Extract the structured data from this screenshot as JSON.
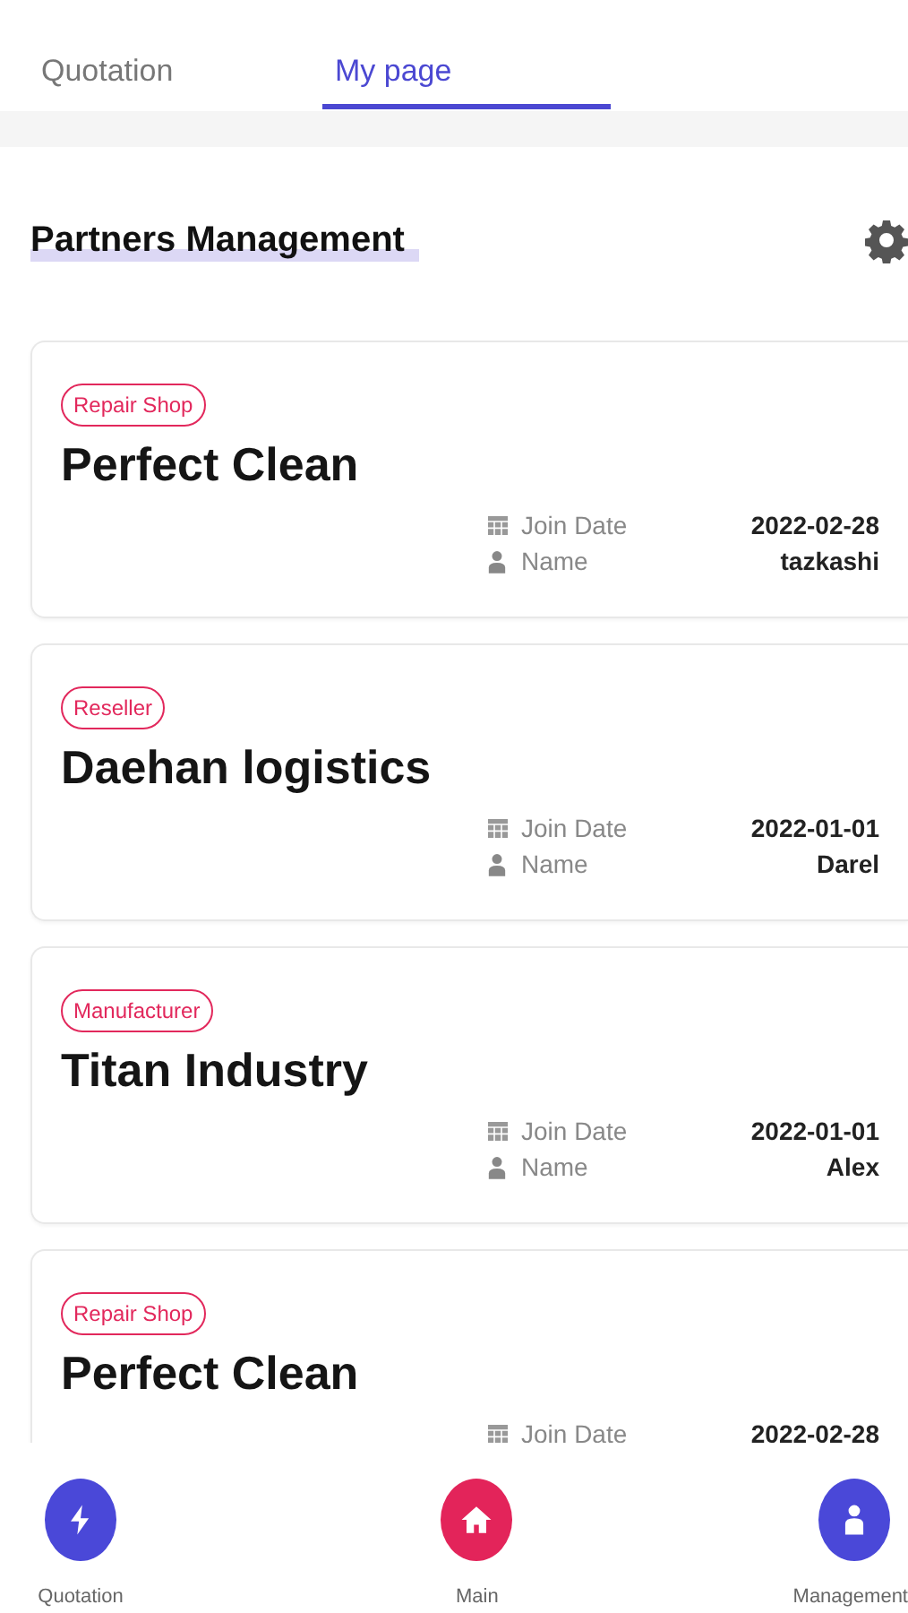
{
  "tabs": [
    {
      "label": "Quotation",
      "selected": false
    },
    {
      "label": "My page",
      "selected": true
    }
  ],
  "section": {
    "title": "Partners Management"
  },
  "partners": [
    {
      "tag": "Repair Shop",
      "name": "Perfect Clean",
      "join_label": "Join Date",
      "join_date": "2022-02-28",
      "name_label": "Name",
      "contact": "tazkashi"
    },
    {
      "tag": "Reseller",
      "name": "Daehan logistics",
      "join_label": "Join Date",
      "join_date": "2022-01-01",
      "name_label": "Name",
      "contact": "Darel"
    },
    {
      "tag": "Manufacturer",
      "name": "Titan Industry",
      "join_label": "Join Date",
      "join_date": "2022-01-01",
      "name_label": "Name",
      "contact": "Alex"
    },
    {
      "tag": "Repair Shop",
      "name": "Perfect Clean",
      "join_label": "Join Date",
      "join_date": "2022-02-28"
    }
  ],
  "bottom_nav": [
    {
      "label": "Quotation",
      "kind": "bolt",
      "color": "#4a48d8"
    },
    {
      "label": "Main",
      "kind": "home",
      "color": "#e3245a"
    },
    {
      "label": "Management",
      "kind": "person",
      "color": "#4a48d8"
    }
  ]
}
